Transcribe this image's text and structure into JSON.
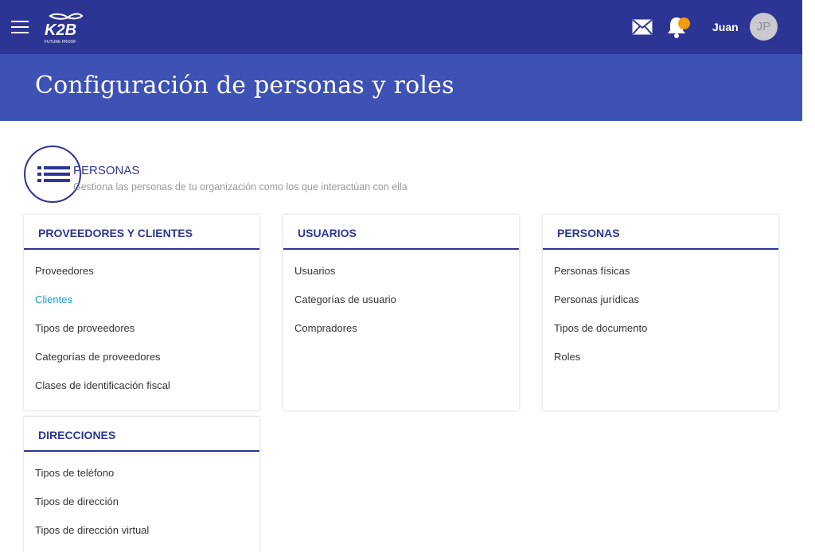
{
  "header": {
    "logo_text": "K2B",
    "logo_tagline": "FUTURE PROOF",
    "username": "Juan",
    "avatar_initials": "JP",
    "notification_color": "#f39c12",
    "icons": [
      "menu-icon",
      "mail-icon",
      "bell-icon"
    ]
  },
  "page": {
    "title": "Configuración de personas y roles"
  },
  "section": {
    "title": "PERSONAS",
    "description": "Gestiona las personas de tu organización como los que interactúan con ella",
    "icon": "list-icon"
  },
  "cards": [
    {
      "title": "PROVEEDORES Y CLIENTES",
      "items": [
        "Proveedores",
        "Clientes",
        "Tipos de proveedores",
        "Categorías de proveedores",
        "Clases de identificación fiscal"
      ]
    },
    {
      "title": "USUARIOS",
      "items": [
        "Usuarios",
        "Categorías de usuario",
        "Compradores"
      ]
    },
    {
      "title": "PERSONAS",
      "items": [
        "Personas físicas",
        "Personas jurídicas",
        "Tipos de documento",
        "Roles"
      ]
    },
    {
      "title": "DIRECCIONES",
      "items": [
        "Tipos de teléfono",
        "Tipos de dirección",
        "Tipos de dirección virtual"
      ]
    }
  ],
  "colors": {
    "topbar": "#2d3594",
    "titlebar": "#3e51b5",
    "accent": "#2d3594",
    "active_link": "#17a2c8"
  }
}
